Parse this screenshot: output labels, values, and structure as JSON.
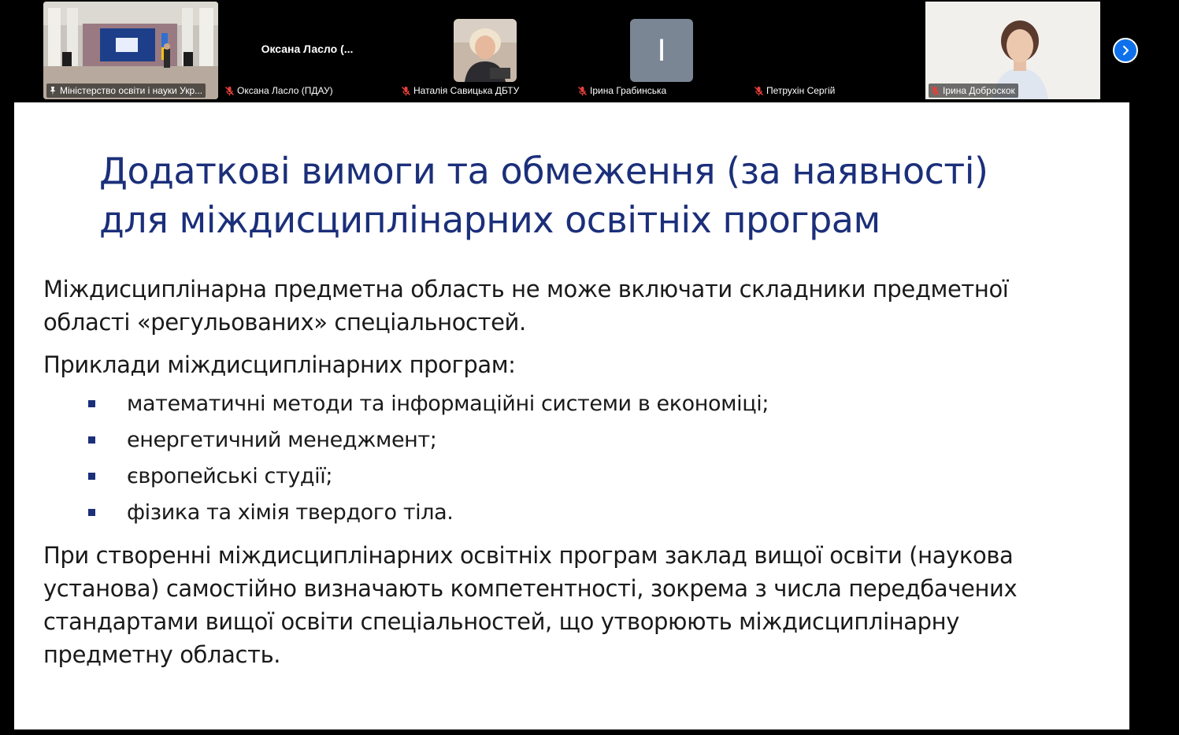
{
  "participants": [
    {
      "name": "Міністерство освіти і науки Укр...",
      "muted": false,
      "pinned": true,
      "active": true,
      "video": "stage-room"
    },
    {
      "name": "Оксана Ласло (ПДАУ)",
      "display": "Оксана  Ласло  (...",
      "muted": true,
      "video": "none"
    },
    {
      "name": "Наталія Савицька ДБТУ",
      "muted": true,
      "video": "photo"
    },
    {
      "name": "Ірина Грабинська",
      "initial": "I",
      "muted": true,
      "video": "initial"
    },
    {
      "name": "Петрухін Сергій",
      "muted": true,
      "video": "none"
    },
    {
      "name": "Ірина Доброскок",
      "muted": true,
      "video": "camera"
    }
  ],
  "icons": {
    "muted_mic": "mic-muted-icon",
    "pin": "pin-icon",
    "next": "chevron-right-icon"
  },
  "colors": {
    "active_border": "#23d959",
    "next_button": "#0e71eb",
    "title": "#1b2f7a",
    "bullet": "#1b2f7a",
    "muted_icon": "#e5413a"
  },
  "slide": {
    "title_line1": "Додаткові вимоги та обмеження (за наявності)",
    "title_line2": "для міждисциплінарних освітніх програм",
    "para1_line1": "Міждисциплінарна предметна область не може включати складники предметної",
    "para1_line2": "області «регульованих» спеціальностей.",
    "para2": "Приклади міждисциплінарних програм:",
    "bullets": [
      "математичні методи та інформаційні системи в економіці;",
      "енергетичний менеджмент;",
      "європейські студії;",
      "фізика та хімія твердого тіла."
    ],
    "para3_line1": "При створенні міждисциплінарних освітніх програм заклад вищої освіти (наукова",
    "para3_line2": "установа) самостійно визначають компетентності, зокрема з числа передбачених",
    "para3_line3": "стандартами вищої освіти спеціальностей, що утворюють міждисциплінарну",
    "para3_line4": "предметну область."
  }
}
